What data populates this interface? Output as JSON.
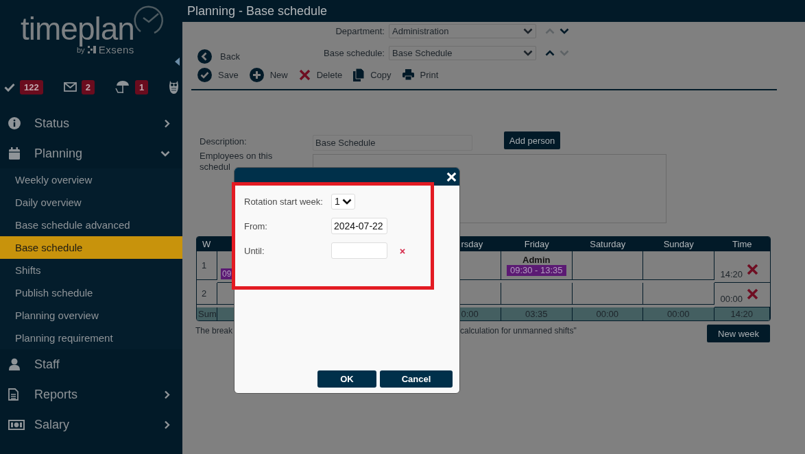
{
  "sidebar": {
    "logo": {
      "name": "timeplan",
      "byline": "by",
      "brand": "Exsens"
    },
    "badges": [
      {
        "kind": "check",
        "count": "122"
      },
      {
        "kind": "mail",
        "count": "2"
      },
      {
        "kind": "umbrella",
        "count": "1"
      },
      {
        "kind": "owl"
      }
    ],
    "menu": [
      {
        "kind": "status",
        "label": "Status",
        "expandable": true,
        "expanded": false
      },
      {
        "kind": "planning",
        "label": "Planning",
        "expandable": true,
        "expanded": true,
        "children": [
          {
            "label": "Weekly overview",
            "selected": false
          },
          {
            "label": "Daily overview",
            "selected": false
          },
          {
            "label": "Base schedule advanced",
            "selected": false
          },
          {
            "label": "Base schedule",
            "selected": true
          },
          {
            "label": "Shifts",
            "selected": false
          },
          {
            "label": "Publish schedule",
            "selected": false
          },
          {
            "label": "Planning overview",
            "selected": false
          },
          {
            "label": "Planning requirement",
            "selected": false
          }
        ]
      },
      {
        "kind": "staff",
        "label": "Staff",
        "expandable": false
      },
      {
        "kind": "reports",
        "label": "Reports",
        "expandable": true,
        "expanded": false
      },
      {
        "kind": "salary",
        "label": "Salary",
        "expandable": true,
        "expanded": false
      }
    ]
  },
  "page_title": "Planning - Base schedule",
  "back": "Back",
  "selectors": [
    {
      "label": "Department:",
      "value": "Administration",
      "up_disabled": true,
      "down_disabled": false
    },
    {
      "label": "Base schedule:",
      "value": "Base Schedule",
      "up_disabled": false,
      "down_disabled": true
    }
  ],
  "toolbar": [
    {
      "kind": "save",
      "label": "Save"
    },
    {
      "kind": "new",
      "label": "New"
    },
    {
      "kind": "delete",
      "label": "Delete"
    },
    {
      "kind": "copy",
      "label": "Copy"
    },
    {
      "kind": "print",
      "label": "Print"
    }
  ],
  "form": {
    "description_label": "Description:",
    "description_value": "Base Schedule",
    "add_person": "Add person",
    "employees_label": "Employees on this schedul"
  },
  "table": {
    "columns": [
      {
        "kind": "week",
        "label": "W"
      },
      {
        "kind": "thursday",
        "label": "rsday"
      },
      {
        "kind": "friday",
        "label": "Friday"
      },
      {
        "kind": "saturday",
        "label": "Saturday"
      },
      {
        "kind": "sunday",
        "label": "Sunday"
      },
      {
        "kind": "time",
        "label": "Time"
      }
    ],
    "rows": [
      {
        "week": "1",
        "time": "14:20",
        "shifts": [
          {
            "kind": "monday",
            "time": "09"
          },
          {
            "kind": "friday",
            "name": "Admin",
            "time": "09:30 - 13:35"
          }
        ]
      },
      {
        "week": "2",
        "time": "00:00",
        "shifts": []
      }
    ],
    "sum": {
      "label": "Sum",
      "cells": [
        {
          "kind": "thursday",
          "text": "0:00"
        },
        {
          "kind": "friday",
          "text": "03:35"
        },
        {
          "kind": "saturday",
          "text": "00:00"
        },
        {
          "kind": "sunday",
          "text": "00:00"
        },
        {
          "kind": "time",
          "text": "14:20"
        }
      ]
    }
  },
  "note_parts": [
    "The break",
    "calculation for unmanned shifts\""
  ],
  "new_week": "New week",
  "dialog": {
    "fields": [
      {
        "kind": "select",
        "label": "Rotation start week:",
        "value": "1"
      },
      {
        "kind": "date",
        "label": "From:",
        "value": "2024-07-22"
      },
      {
        "kind": "date",
        "label": "Until:",
        "clearable": true
      }
    ],
    "buttons": [
      {
        "kind": "ok",
        "label": "OK"
      },
      {
        "kind": "cancel",
        "label": "Cancel"
      }
    ]
  }
}
